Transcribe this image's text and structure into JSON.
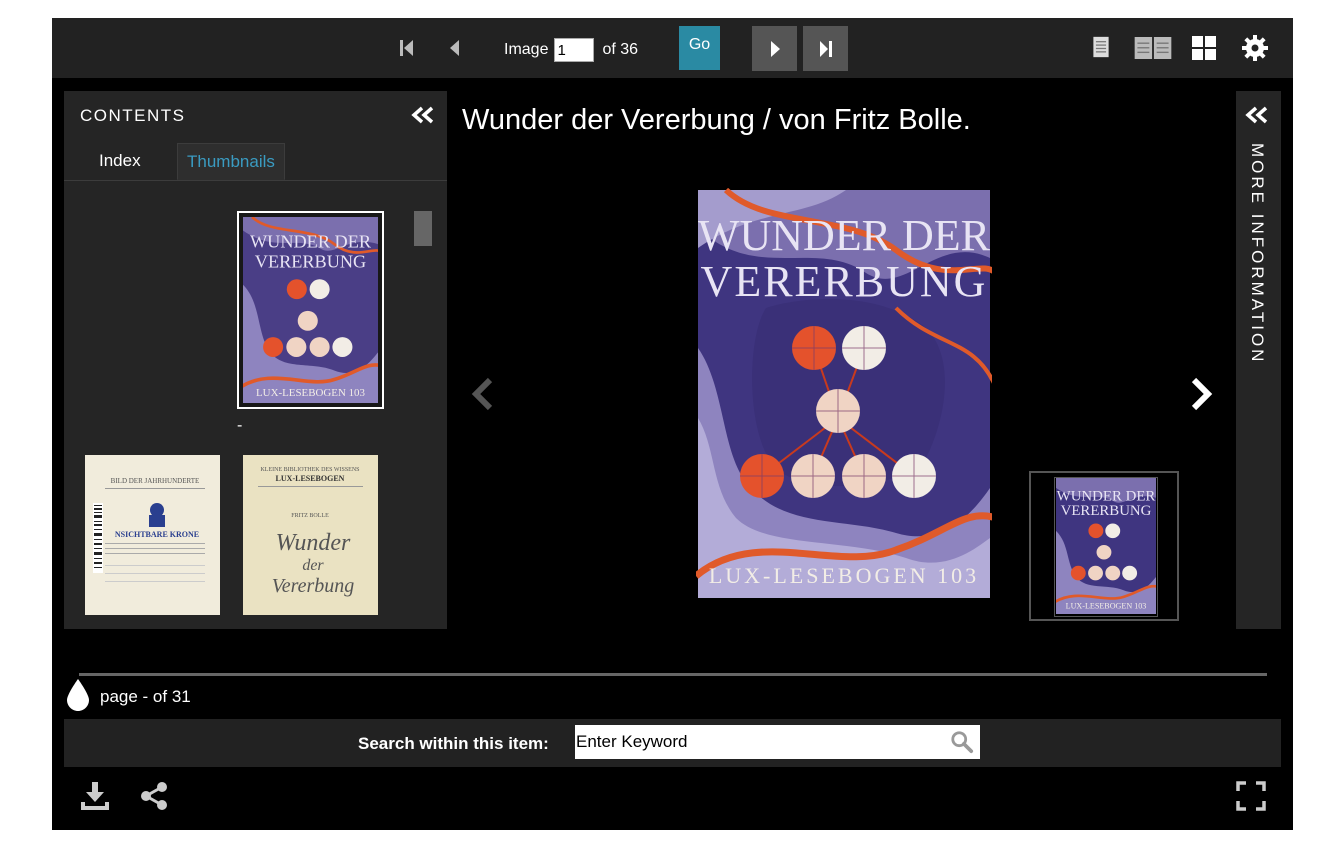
{
  "toolbar": {
    "page_label": "Image",
    "page_value": "1",
    "page_total": "of 36",
    "go_label": "Go",
    "icons": [
      "first-page-icon",
      "previous-page-icon",
      "next-page-icon",
      "last-page-icon",
      "single-page-view-icon",
      "two-page-view-icon",
      "grid-view-icon",
      "settings-icon"
    ],
    "accent_color": "#2a8aa3"
  },
  "contents": {
    "title": "CONTENTS",
    "tabs": [
      {
        "label": "Index",
        "active": false
      },
      {
        "label": "Thumbnails",
        "active": true
      }
    ],
    "selected_thumb_label": "-",
    "active_tab_color": "#3a9bc1"
  },
  "thumbnails": [
    {
      "title_line1": "WUNDER DER",
      "title_line2": "VERERBUNG",
      "footer": "LUX-LESEBOGEN 103"
    },
    {
      "header": "BILD DER JAHRHUNDERTE",
      "title": "NSICHTBARE KRONE"
    },
    {
      "header_line1": "KLEINE BIBLIOTHEK DES WISSENS",
      "header_line2": "LUX-LESEBOGEN",
      "author": "FRITZ BOLLE",
      "title_line1": "Wunder",
      "title_line2": "der",
      "title_line3": "Vererbung"
    }
  ],
  "main": {
    "title": "Wunder der Vererbung / von Fritz Bolle.",
    "cover": {
      "title_line1": "WUNDER DER",
      "title_line2": "VERERBUNG",
      "footer": "LUX-LESEBOGEN 103"
    },
    "navigator": {
      "title_line1": "WUNDER DER",
      "title_line2": "VERERBUNG",
      "footer": "LUX-LESEBOGEN 103"
    }
  },
  "more_info": {
    "label": "MORE INFORMATION"
  },
  "pager": {
    "text": "page - of 31"
  },
  "search": {
    "label": "Search within this item:",
    "placeholder": "Enter Keyword"
  }
}
